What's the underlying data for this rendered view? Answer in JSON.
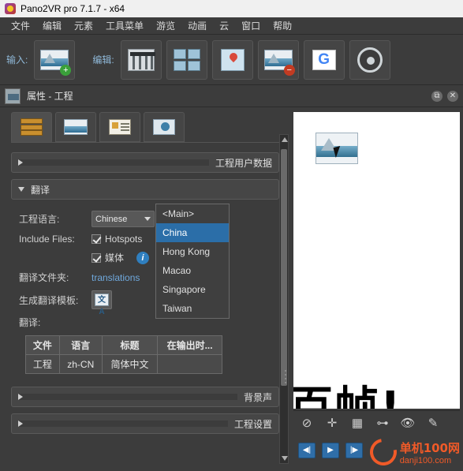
{
  "titlebar": {
    "title": "Pano2VR pro 7.1.7 - x64",
    "icon": "app-icon"
  },
  "menubar": {
    "items": [
      "文件",
      "编辑",
      "元素",
      "工具菜单",
      "游览",
      "动画",
      "云",
      "窗口",
      "帮助"
    ]
  },
  "toolbar": {
    "input_label": "输入:",
    "edit_label": "编辑:",
    "buttons": [
      {
        "name": "add-panorama",
        "icon": "panorama-plus-icon"
      },
      {
        "name": "adjust-levels",
        "icon": "sliders-icon"
      },
      {
        "name": "patch-tool",
        "icon": "grid-panels-icon"
      },
      {
        "name": "hotspot-tool",
        "icon": "map-pin-icon"
      },
      {
        "name": "remove-panorama",
        "icon": "panorama-minus-icon"
      },
      {
        "name": "google-street-view",
        "icon": "google-g-icon"
      },
      {
        "name": "video-output",
        "icon": "film-reel-icon"
      }
    ]
  },
  "panel": {
    "icon": "panorama-properties-icon",
    "title": "属性 - 工程",
    "float_button": "float-icon",
    "close_button": "close-icon",
    "tabs": [
      {
        "name": "tab-layers",
        "icon": "layers-icon",
        "active": true
      },
      {
        "name": "tab-panorama",
        "icon": "panorama-icon",
        "active": false
      },
      {
        "name": "tab-details",
        "icon": "card-icon",
        "active": false
      },
      {
        "name": "tab-output",
        "icon": "globe-icon",
        "active": false
      }
    ],
    "sections": {
      "user_data": {
        "label": "工程用户数据",
        "expanded": false
      },
      "translation": {
        "label": "翻译",
        "expanded": true
      },
      "background_sound": {
        "label": "背景声",
        "expanded": false
      },
      "project_settings": {
        "label": "工程设置",
        "expanded": false
      }
    },
    "translation": {
      "project_language_label": "工程语言:",
      "project_language_value": "Chinese",
      "project_language_code": "CN",
      "include_files_label": "Include Files:",
      "hotspots_label": "Hotspots",
      "hotspots_checked": true,
      "media_label": "媒体",
      "media_checked": true,
      "info_icon": "info-icon",
      "translation_folder_label": "翻译文件夹:",
      "translation_folder_value": "translations",
      "generate_template_label": "生成翻译模板:",
      "generate_template_icon": "translate-icon",
      "translate_label": "翻译:",
      "table": {
        "headers": [
          "文件",
          "语言",
          "标题",
          "在输出时..."
        ],
        "rows": [
          [
            "工程",
            "zh-CN",
            "简体中文",
            ""
          ]
        ]
      }
    },
    "dropdown": {
      "open": true,
      "options": [
        "<Main>",
        "China",
        "Hong Kong",
        "Macao",
        "Singapore",
        "Taiwan"
      ],
      "selected": "China"
    },
    "scrollbar": {
      "name": "panel-vertical-scrollbar"
    }
  },
  "preview": {
    "thumbnail": "panorama-thumbnail",
    "cursor": "mouse-cursor",
    "big_text": "百帧!",
    "tools": [
      {
        "name": "pan-tool",
        "glyph": "⊘"
      },
      {
        "name": "crosshair-tool",
        "glyph": "✛"
      },
      {
        "name": "grid-tool",
        "glyph": "▦"
      },
      {
        "name": "measure-tool",
        "glyph": "⊶"
      },
      {
        "name": "view-tool",
        "glyph": "👁"
      },
      {
        "name": "brush-tool",
        "glyph": "✎"
      }
    ],
    "playback": [
      {
        "name": "previous-button",
        "glyph": "◀|"
      },
      {
        "name": "play-button",
        "glyph": "▶"
      },
      {
        "name": "next-button",
        "glyph": "|▶"
      }
    ],
    "watermark": {
      "text": "单机100网",
      "sub": "danji100.com",
      "color": "#f05a28"
    }
  },
  "colors": {
    "accent": "#2b6ea8",
    "link": "#6fa8dc",
    "panel_bg": "#3c3c3c",
    "watermark": "#f05a28"
  }
}
